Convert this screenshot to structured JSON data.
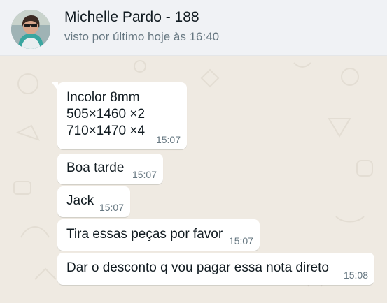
{
  "header": {
    "contact_name": "Michelle Pardo - 188",
    "status": "visto por último hoje às 16:40"
  },
  "messages": [
    {
      "lines": [
        "Incolor 8mm",
        "505×1460 ×2",
        "710×1470 ×4"
      ],
      "time": "15:07"
    },
    {
      "lines": [
        "Boa tarde"
      ],
      "time": "15:07"
    },
    {
      "lines": [
        "Jack"
      ],
      "time": "15:07"
    },
    {
      "lines": [
        "Tira essas peças por favor"
      ],
      "time": "15:07"
    },
    {
      "lines": [
        "Dar o desconto q vou pagar essa nota direto"
      ],
      "time": "15:08"
    }
  ],
  "colors": {
    "chat_background": "#efeae2",
    "header_background": "#f0f2f5",
    "bubble": "#ffffff",
    "timestamp": "#667781"
  },
  "icons": {
    "avatar": "profile-photo-avatar"
  }
}
